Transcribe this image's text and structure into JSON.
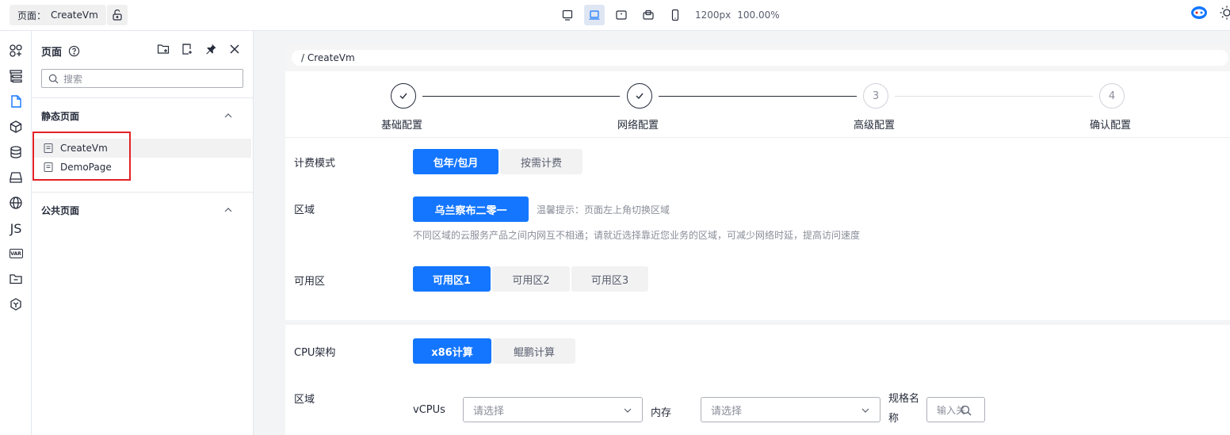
{
  "topbar": {
    "page_prefix": "页面：",
    "page_name": "CreateVm",
    "width_readout": "1200px",
    "zoom_readout": "100.00%",
    "device_icons": [
      "desktop-icon",
      "laptop-icon",
      "tablet-landscape-icon",
      "tablet-rotate-icon",
      "mobile-icon"
    ]
  },
  "rail": {
    "items": [
      "components-icon",
      "outline-icon",
      "page-icon",
      "block-icon",
      "datasource-icon",
      "storage-icon",
      "i18n-icon",
      "js-icon",
      "var-icon",
      "folder-icon",
      "plugin-icon"
    ],
    "js_label": "JS",
    "var_label": "VAR"
  },
  "panel": {
    "title": "页面",
    "search_placeholder": "搜索",
    "static_section": "静态页面",
    "public_section": "公共页面",
    "static_pages": [
      "CreateVm",
      "DemoPage"
    ]
  },
  "canvas": {
    "breadcrumb": "/ CreateVm",
    "steps": [
      {
        "label": "基础配置",
        "mark": "✓"
      },
      {
        "label": "网络配置",
        "mark": "✓"
      },
      {
        "label": "高级配置",
        "mark": "3"
      },
      {
        "label": "确认配置",
        "mark": "4"
      }
    ],
    "billing": {
      "label": "计费模式",
      "options": [
        "包年/包月",
        "按需计费"
      ]
    },
    "region": {
      "label": "区域",
      "option": "乌兰察布二零一",
      "tip": "温馨提示：页面左上角切换区域",
      "note": "不同区域的云服务产品之间内网互不相通；请就近选择靠近您业务的区域，可减少网络时延，提高访问速度"
    },
    "zone": {
      "label": "可用区",
      "options": [
        "可用区1",
        "可用区2",
        "可用区3"
      ]
    },
    "cpu": {
      "label": "CPU架构",
      "options": [
        "x86计算",
        "鲲鹏计算"
      ]
    },
    "spec": {
      "label": "区域",
      "vcpus_label": "vCPUs",
      "vcpus_placeholder": "请选择",
      "memory_label": "内存",
      "memory_placeholder": "请选择",
      "name_label": "规格名称",
      "name_placeholder": "输入关"
    }
  },
  "colors": {
    "primary": "#1476ff",
    "highlight": "#e32026"
  }
}
